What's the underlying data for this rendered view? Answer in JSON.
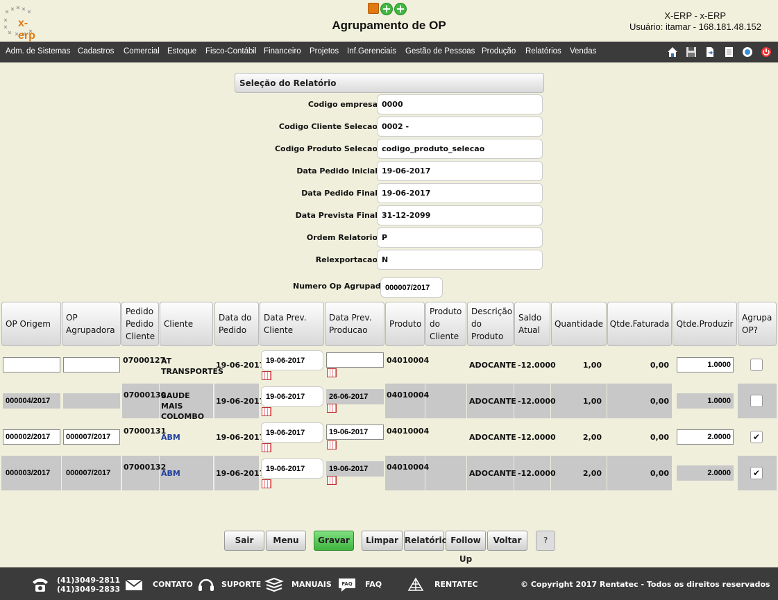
{
  "header": {
    "logo_text": "x-erp",
    "title": "Agrupamento de OP",
    "user_line1": "X-ERP - x-ERP",
    "user_line2": "Usuário: itamar - 168.181.48.152"
  },
  "nav": {
    "items": [
      "Adm. de Sistemas",
      "Cadastros",
      "Comercial",
      "Estoque",
      "Fisco-Contábil",
      "Financeiro",
      "Projetos",
      "Inf.Gerenciais",
      "Gestão de Pessoas",
      "Produção",
      "Relatórios",
      "Vendas"
    ],
    "icons": [
      "home-icon",
      "save-icon",
      "export-icon",
      "document-icon",
      "help-icon",
      "power-icon"
    ]
  },
  "form": {
    "section_title": "Seleção do Relatório",
    "fields": [
      {
        "label": "Codigo empresa",
        "value": "0000"
      },
      {
        "label": "Codigo Cliente Selecao",
        "value": "0002 -"
      },
      {
        "label": "Codigo Produto Selecao",
        "value": "codigo_produto_selecao"
      },
      {
        "label": "Data Pedido Inicial",
        "value": "19-06-2017"
      },
      {
        "label": "Data Pedido Final",
        "value": "19-06-2017"
      },
      {
        "label": "Data Prevista Final",
        "value": "31-12-2099"
      },
      {
        "label": "Ordem Relatorio",
        "value": "P"
      },
      {
        "label": "Relexportacao",
        "value": "N"
      }
    ],
    "numero_op_label": "Numero Op Agrupadora",
    "numero_op_value": "000007/2017"
  },
  "table": {
    "headers": [
      "OP Origem",
      "OP Agrupadora",
      "Pedido Pedido Cliente",
      "Cliente",
      "Data do Pedido",
      "Data Prev. Cliente",
      "Data Prev. Producao",
      "Produto",
      "Produto do Cliente",
      "Descrição do Produto",
      "Saldo Atual",
      "Quantidade",
      "Qtde.Faturada",
      "Qtde.Produzir",
      "Agrupa OP?"
    ],
    "rows": [
      {
        "op_origem": "",
        "op_agrupadora": "",
        "pedido": "07000127",
        "cliente": "AT TRANSPORTES",
        "data_pedido": "19-06-2017",
        "data_prev_cliente": "19-06-2017",
        "data_prev_producao": "",
        "produto": "04010004",
        "produto_cliente": "",
        "descricao": "ADOCANTE",
        "saldo": "-12.0000",
        "quantidade": "1,00",
        "faturada": "0,00",
        "produzir": "1.0000",
        "agrupa": ""
      },
      {
        "op_origem": "000004/2017",
        "op_agrupadora": "",
        "pedido": "07000130",
        "cliente": "SAUDE MAIS COLOMBO",
        "data_pedido": "19-06-2017",
        "data_prev_cliente": "19-06-2017",
        "data_prev_producao": "26-06-2017",
        "produto": "04010004",
        "produto_cliente": "",
        "descricao": "ADOCANTE",
        "saldo": "-12.0000",
        "quantidade": "1,00",
        "faturada": "0,00",
        "produzir": "1.0000",
        "agrupa": ""
      },
      {
        "op_origem": "000002/2017",
        "op_agrupadora": "000007/2017",
        "pedido": "07000131",
        "cliente": "ABM",
        "data_pedido": "19-06-2017",
        "data_prev_cliente": "19-06-2017",
        "data_prev_producao": "19-06-2017",
        "produto": "04010004",
        "produto_cliente": "",
        "descricao": "ADOCANTE",
        "saldo": "-12.0000",
        "quantidade": "2,00",
        "faturada": "0,00",
        "produzir": "2.0000",
        "agrupa": "✔"
      },
      {
        "op_origem": "000003/2017",
        "op_agrupadora": "000007/2017",
        "pedido": "07000132",
        "cliente": "ABM",
        "data_pedido": "19-06-2017",
        "data_prev_cliente": "19-06-2017",
        "data_prev_producao": "19-06-2017",
        "produto": "04010004",
        "produto_cliente": "",
        "descricao": "ADOCANTE",
        "saldo": "-12.0000",
        "quantidade": "2,00",
        "faturada": "0,00",
        "produzir": "2.0000",
        "agrupa": "✔"
      }
    ]
  },
  "buttons": {
    "sair": "Sair",
    "menu": "Menu",
    "gravar": "Gravar",
    "limpar": "Limpar",
    "relatorio": "Relatório",
    "followup": "Follow Up",
    "voltar": "Voltar",
    "help": "?"
  },
  "footer": {
    "phone1": "(41)3049-2811",
    "phone2": "(41)3049-2833",
    "contato": "CONTATO",
    "suporte": "SUPORTE",
    "manuais": "MANUAIS",
    "faq": "FAQ",
    "faq_icon_text": "FAQ",
    "rentatec": "RENTATEC",
    "copyright": "© Copyright 2017 Rentatec - Todos os direitos reservados"
  },
  "colors": {
    "nav_bg": "#3b3b3b",
    "page_bg": "#efefdc",
    "row_grey": "#c8c8c8",
    "gravar_green": "#4cc24c",
    "logo_orange": "#e07a12"
  }
}
